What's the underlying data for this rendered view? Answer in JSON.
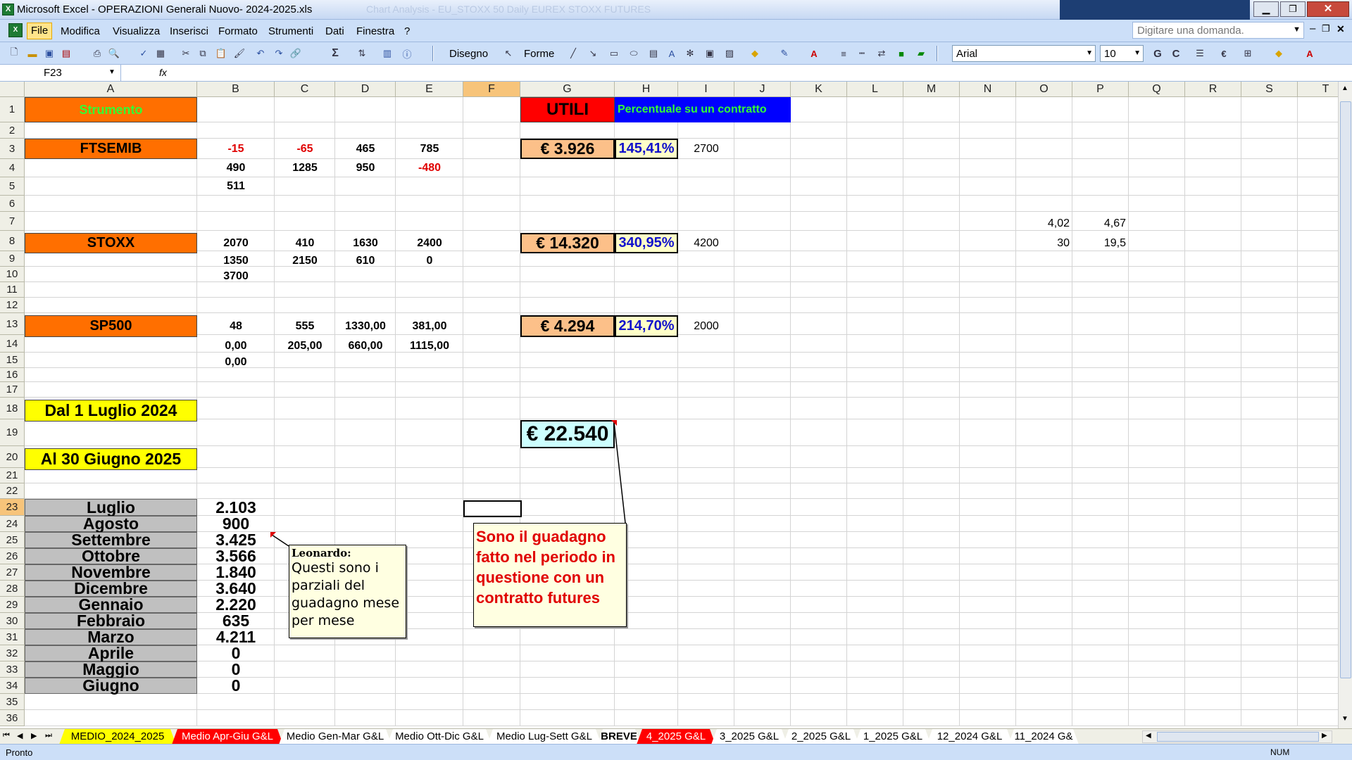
{
  "window": {
    "title": "Microsoft Excel - OPERAZIONI Generali Nuovo- 2024-2025.xls",
    "bg_title_ghost": "Chart Analysis - EU_STOXX 50 Daily EUREX STOXX FUTURES"
  },
  "menu": [
    "File",
    "Modifica",
    "Visualizza",
    "Inserisci",
    "Formato",
    "Strumenti",
    "Dati",
    "Finestra",
    "?"
  ],
  "help_placeholder": "Digitare una domanda.",
  "drawing": {
    "disegno": "Disegno",
    "forme": "Forme"
  },
  "font": {
    "name": "Arial",
    "size": "10",
    "bold": "G",
    "italic": "C"
  },
  "namebox": "F23",
  "fx": "fx",
  "columns": [
    "A",
    "B",
    "C",
    "D",
    "E",
    "F",
    "G",
    "H",
    "I",
    "J",
    "K",
    "L",
    "M",
    "N",
    "O",
    "P",
    "Q",
    "R",
    "S",
    "T"
  ],
  "rows": [
    "1",
    "2",
    "3",
    "4",
    "5",
    "6",
    "7",
    "8",
    "9",
    "10",
    "11",
    "12",
    "13",
    "14",
    "15",
    "16",
    "17",
    "18",
    "19",
    "20",
    "21",
    "22",
    "23",
    "24",
    "25",
    "26",
    "27",
    "28",
    "29",
    "30",
    "31",
    "32",
    "33",
    "34",
    "35",
    "36"
  ],
  "header": {
    "strumento": "Strumento",
    "utili": "UTILI",
    "percentuale": "Percentuale su un contratto"
  },
  "ftsemib": {
    "label": "FTSEMIB",
    "r3": [
      "-15",
      "-65",
      "465",
      "785"
    ],
    "r4": [
      "490",
      "1285",
      "950",
      "-480"
    ],
    "r5": "511",
    "utile": "€ 3.926",
    "pct": "145,41%",
    "margin": "2700"
  },
  "stoxx": {
    "label": "STOXX",
    "r8": [
      "2070",
      "410",
      "1630",
      "2400"
    ],
    "r9": [
      "1350",
      "2150",
      "610",
      "0"
    ],
    "r10": "3700",
    "utile": "€ 14.320",
    "pct": "340,95%",
    "margin": "4200"
  },
  "sp500": {
    "label": "SP500",
    "r13": [
      "48",
      "555",
      "1330,00",
      "381,00"
    ],
    "r14": [
      "0,00",
      "205,00",
      "660,00",
      "1115,00"
    ],
    "r15": "0,00",
    "utile": "€ 4.294",
    "pct": "214,70%",
    "margin": "2000"
  },
  "extra": {
    "o7": "4,02",
    "p7": "4,67",
    "o8": "30",
    "p8": "19,5"
  },
  "period": {
    "from": "Dal 1 Luglio  2024",
    "to": "Al 30 Giugno 2025",
    "total": "€ 22.540"
  },
  "months": [
    {
      "name": "Luglio",
      "value": "2.103"
    },
    {
      "name": "Agosto",
      "value": "900"
    },
    {
      "name": "Settembre",
      "value": "3.425"
    },
    {
      "name": "Ottobre",
      "value": "3.566"
    },
    {
      "name": "Novembre",
      "value": "1.840"
    },
    {
      "name": "Dicembre",
      "value": "3.640"
    },
    {
      "name": "Gennaio",
      "value": "2.220"
    },
    {
      "name": "Febbraio",
      "value": "635"
    },
    {
      "name": "Marzo",
      "value": "4.211"
    },
    {
      "name": "Aprile",
      "value": "0"
    },
    {
      "name": "Maggio",
      "value": "0"
    },
    {
      "name": "Giugno",
      "value": "0"
    }
  ],
  "comment1": {
    "author": "Leonardo:",
    "text": "Questi sono i parziali del guadagno mese per mese"
  },
  "comment2": {
    "text": "Sono il guadagno fatto nel periodo in questione con un contratto futures"
  },
  "tabs": [
    {
      "label": "MEDIO_2024_2025",
      "color": "#ffff00",
      "text": "#000"
    },
    {
      "label": "Medio Apr-Giu G&L",
      "color": "#ff0000",
      "text": "#fff"
    },
    {
      "label": "Medio Gen-Mar G&L",
      "color": "#ffffff",
      "text": "#000"
    },
    {
      "label": "Medio Ott-Dic G&L",
      "color": "#ffffff",
      "text": "#000"
    },
    {
      "label": "Medio Lug-Sett G&L",
      "color": "#ffffff",
      "text": "#000"
    },
    {
      "label": "BREVE",
      "color": "#ffffff",
      "text": "#000"
    },
    {
      "label": "4_2025 G&L",
      "color": "#ff0000",
      "text": "#fff"
    },
    {
      "label": "3_2025 G&L",
      "color": "#ffffff",
      "text": "#000"
    },
    {
      "label": "2_2025 G&L",
      "color": "#ffffff",
      "text": "#000"
    },
    {
      "label": "1_2025 G&L",
      "color": "#ffffff",
      "text": "#000"
    },
    {
      "label": "12_2024 G&L",
      "color": "#ffffff",
      "text": "#000"
    },
    {
      "label": "11_2024 G&",
      "color": "#ffffff",
      "text": "#000"
    }
  ],
  "status": {
    "left": "Pronto",
    "num": "NUM"
  }
}
